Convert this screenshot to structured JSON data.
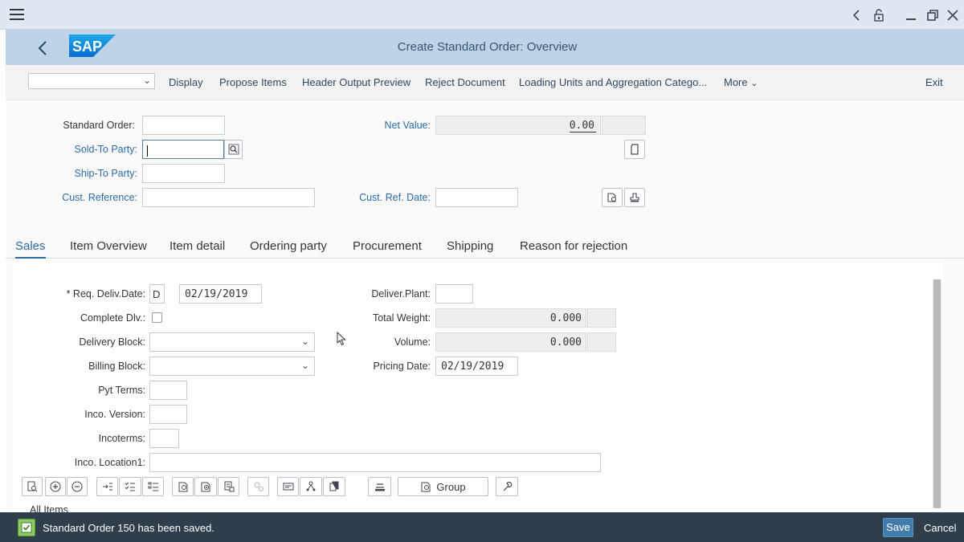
{
  "app": {
    "title": "Create Standard Order: Overview",
    "logo_text": "SAP"
  },
  "window_controls": [
    "chevron-left-icon",
    "unlock-icon",
    "minimize-icon",
    "restore-icon",
    "close-icon"
  ],
  "toolbar": {
    "select_value": "",
    "items": [
      "Display",
      "Propose Items",
      "Header Output Preview",
      "Reject Document",
      "Loading Units and Aggregation Catego...",
      "More"
    ],
    "exit_label": "Exit"
  },
  "header_fields": {
    "standard_order": {
      "label": "Standard Order:",
      "value": ""
    },
    "sold_to_party": {
      "label": "Sold-To Party:",
      "value": ""
    },
    "ship_to_party": {
      "label": "Ship-To Party:",
      "value": ""
    },
    "cust_reference": {
      "label": "Cust. Reference:",
      "value": ""
    },
    "net_value": {
      "label": "Net Value:",
      "value": "0.00",
      "currency": ""
    },
    "cust_ref_date": {
      "label": "Cust. Ref. Date:",
      "value": ""
    }
  },
  "tabs": [
    "Sales",
    "Item Overview",
    "Item detail",
    "Ordering party",
    "Procurement",
    "Shipping",
    "Reason for rejection"
  ],
  "active_tab": "Sales",
  "sales": {
    "req_deliv_date": {
      "label": "* Req. Deliv.Date:",
      "format": "D",
      "value": "02/19/2019"
    },
    "complete_dlv": {
      "label": "Complete Dlv.:",
      "checked": false
    },
    "delivery_block": {
      "label": "Delivery Block:",
      "value": ""
    },
    "billing_block": {
      "label": "Billing Block:",
      "value": ""
    },
    "pyt_terms": {
      "label": "Pyt Terms:",
      "value": ""
    },
    "inco_version": {
      "label": "Inco. Version:",
      "value": ""
    },
    "incoterms": {
      "label": "Incoterms:",
      "value": ""
    },
    "inco_location1": {
      "label": "Inco. Location1:",
      "value": ""
    },
    "deliver_plant": {
      "label": "Deliver.Plant:",
      "value": ""
    },
    "total_weight": {
      "label": "Total Weight:",
      "value": "0.000",
      "unit": ""
    },
    "volume": {
      "label": "Volume:",
      "value": "0.000",
      "unit": ""
    },
    "pricing_date": {
      "label": "Pricing Date:",
      "value": "02/19/2019"
    }
  },
  "grid_toolbar": {
    "group_label": "Group"
  },
  "items_section": {
    "title": "All Items"
  },
  "status": {
    "message": "Standard Order 150 has been saved.",
    "save_label": "Save",
    "cancel_label": "Cancel"
  },
  "colors": {
    "header_bg": "#bcd3e8",
    "accent": "#2a6aa8",
    "status_bg": "#2f3e4b",
    "success": "#8ccb63",
    "primary_button": "#427cac"
  }
}
